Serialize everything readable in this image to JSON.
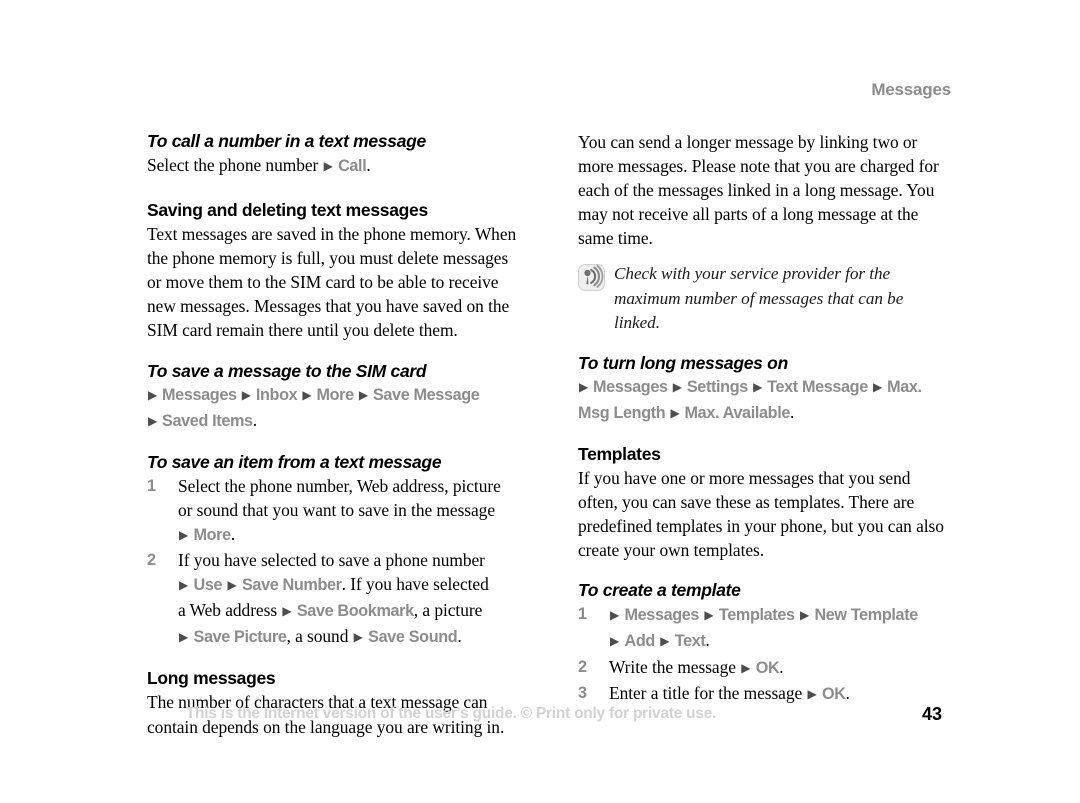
{
  "header": {
    "chapter_title": "Messages"
  },
  "left_column": {
    "blocks": [
      {
        "task_heading": "To call a number in a text message",
        "line_prefix": "Select the phone number ",
        "menu_item": "Call",
        "period": "."
      },
      {
        "section_heading": "Saving and deleting text messages",
        "paragraph": "Text messages are saved in the phone memory. When the phone memory is full, you must delete messages or move them to the SIM card to be able to receive new messages. Messages that you have saved on the SIM card remain there until you delete them."
      },
      {
        "task_heading": "To save a message to the SIM card",
        "path_line1": [
          "Messages",
          "Inbox",
          "More",
          "Save Message"
        ],
        "path_line2": [
          "Saved Items"
        ],
        "period": "."
      },
      {
        "task_heading": "To save an item from a text message",
        "steps": [
          {
            "num": "1",
            "text_part1": "Select the phone number, Web address, picture or sound that you want to save in the message",
            "sub_path": [
              "More"
            ],
            "period": "."
          },
          {
            "num": "2",
            "text_part1": "If you have selected to save a phone number",
            "sub_line1_paths": [
              "Use",
              "Save Number"
            ],
            "sub_line1_tail": ". If you have selected",
            "sub_line2_lead": "a Web address ",
            "sub_line2_menu": "Save Bookmark",
            "sub_line2_tail": ", a picture",
            "sub_line3_menu1": "Save Picture",
            "sub_line3_mid": ", a sound ",
            "sub_line3_menu2": "Save Sound",
            "period": "."
          }
        ]
      },
      {
        "section_heading": "Long messages",
        "paragraph": "The number of characters that a text message can contain depends on the language you are writing in."
      }
    ]
  },
  "right_column": {
    "intro_paragraph": "You can send a longer message by linking two or more messages. Please note that you are charged for each of the messages linked in a long message. You may not receive all parts of a long message at the same time.",
    "note": {
      "icon": "broadcast-signal-icon",
      "text": "Check with your service provider for the maximum number of messages that can be linked."
    },
    "blocks": [
      {
        "task_heading": "To turn long messages on",
        "path_items": [
          "Messages",
          "Settings",
          "Text Message",
          "Max. Msg Length",
          "Max. Available"
        ],
        "period": "."
      },
      {
        "section_heading": "Templates",
        "paragraph": "If you have one or more messages that you send often, you can save these as templates. There are predefined templates in your phone, but you can also create your own templates."
      },
      {
        "task_heading": "To create a template",
        "steps": [
          {
            "num": "1",
            "path_line1": [
              "Messages",
              "Templates",
              "New Template"
            ],
            "path_line2": [
              "Add",
              "Text"
            ],
            "period": "."
          },
          {
            "num": "2",
            "text_part1": "Write the message ",
            "menu_item": "OK",
            "period": "."
          },
          {
            "num": "3",
            "text_part1": "Enter a title for the message ",
            "menu_item": "OK",
            "period": "."
          }
        ]
      }
    ]
  },
  "footer": {
    "notice": "This is the Internet version of the user's guide. © Print only for private use.",
    "page_number": "43"
  },
  "colors": {
    "menu_gray": "#8c8c8c",
    "triangle_gray": "#4d4d4d",
    "footer_gray": "#d2d2d2",
    "text_black": "#000000"
  }
}
